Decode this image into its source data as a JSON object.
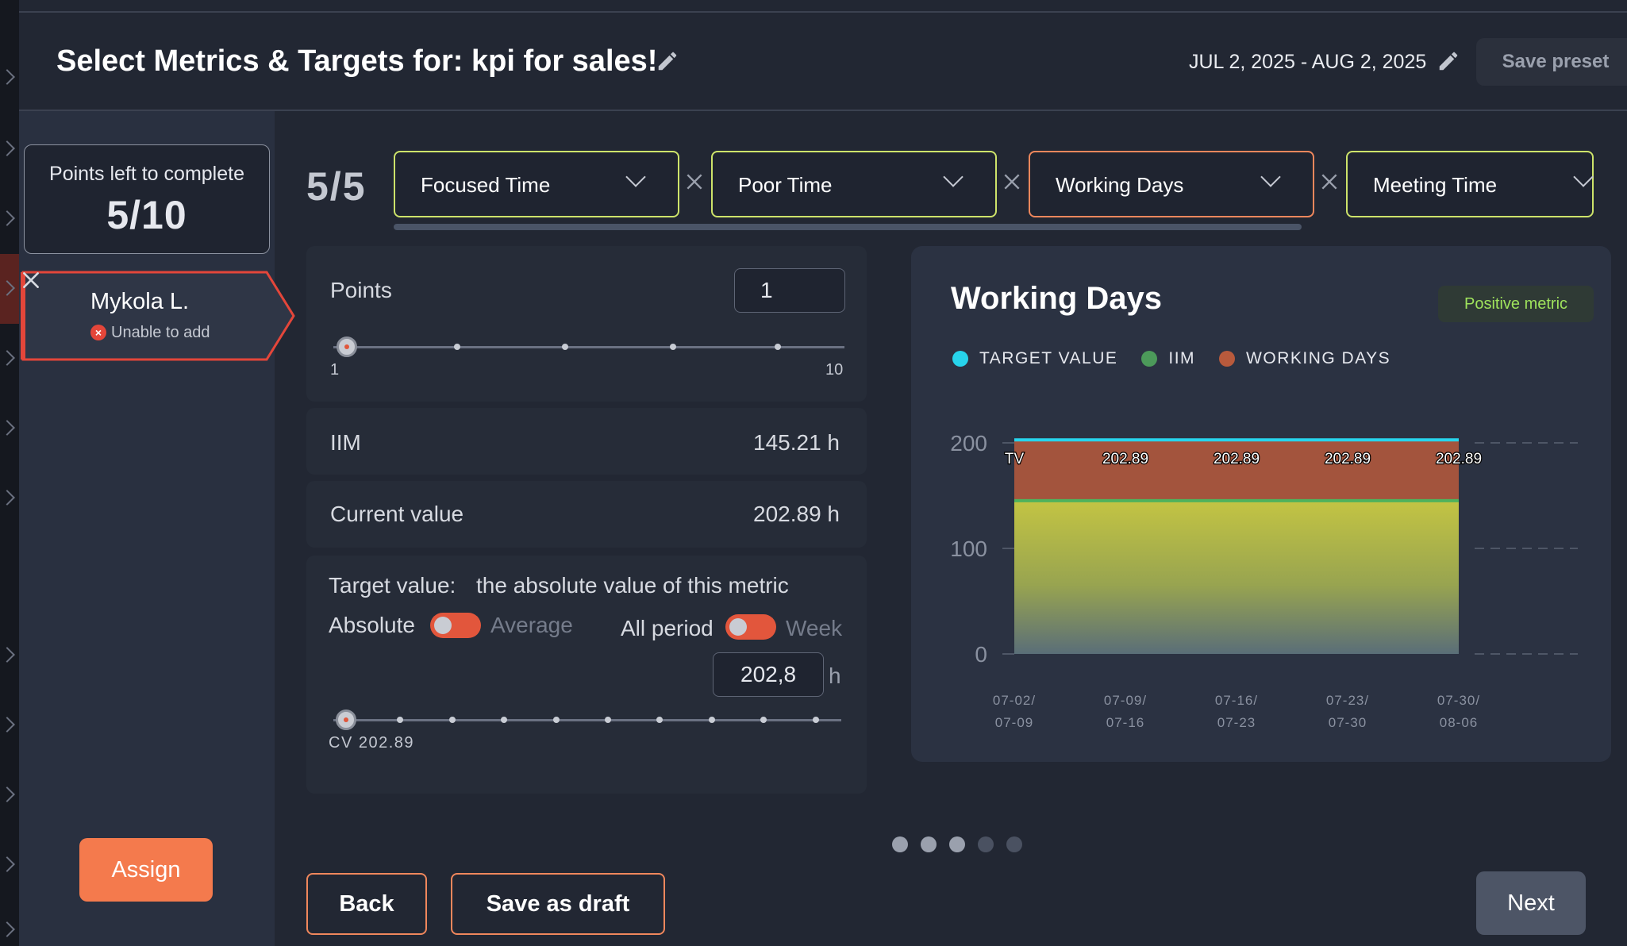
{
  "header": {
    "title": "Select Metrics & Targets for: kpi for sales!",
    "date_range": "JUL 2, 2025 - AUG 2, 2025",
    "save_preset": "Save preset"
  },
  "sidebar": {
    "points_label": "Points left to complete",
    "points_value": "5/10",
    "user": {
      "name": "Mykola L.",
      "status": "Unable to add"
    },
    "assign": "Assign"
  },
  "metrics": {
    "count": "5/5",
    "items": [
      {
        "label": "Focused Time",
        "state": "valid"
      },
      {
        "label": "Poor Time",
        "state": "valid"
      },
      {
        "label": "Working Days",
        "state": "selected"
      },
      {
        "label": "Meeting Time",
        "state": "valid"
      }
    ],
    "colors": {
      "valid": "#cde36a",
      "selected": "#f0875c"
    }
  },
  "settings": {
    "points_label": "Points",
    "points_value": "1",
    "points_min": "1",
    "points_max": "10",
    "points_level": 0,
    "iim_label": "IIM",
    "iim_value": "145.21 h",
    "current_label": "Current value",
    "current_value": "202.89 h",
    "target_label": "Target value:",
    "target_desc": "the absolute value of this metric",
    "absolute": "Absolute",
    "average": "Average",
    "all_period": "All period",
    "week": "Week",
    "target_value": "202,8",
    "target_unit": "h",
    "cv_label": "CV 202.89"
  },
  "chart": {
    "title": "Working Days",
    "badge": "Positive metric",
    "legend": [
      {
        "label": "TARGET VALUE",
        "color": "#27d4ec"
      },
      {
        "label": "IIM",
        "color": "#4c9a5a"
      },
      {
        "label": "WORKING DAYS",
        "color": "#b85a3c"
      }
    ]
  },
  "chart_data": {
    "type": "area",
    "title": "Working Days",
    "categories": [
      "07-02/07-09",
      "07-09/07-16",
      "07-16/07-23",
      "07-23/07-30",
      "07-30/08-06"
    ],
    "category_lines": [
      [
        "07-02/",
        "07-09"
      ],
      [
        "07-09/",
        "07-16"
      ],
      [
        "07-16/",
        "07-23"
      ],
      [
        "07-23/",
        "07-30"
      ],
      [
        "07-30/",
        "08-06"
      ]
    ],
    "y_ticks": [
      "200",
      "100",
      "0"
    ],
    "ylim": [
      0,
      200
    ],
    "series": [
      {
        "name": "TARGET VALUE",
        "values": [
          202.8,
          202.8,
          202.8,
          202.8,
          202.8
        ],
        "color": "#27d4ec"
      },
      {
        "name": "IIM",
        "values": [
          145.21,
          145.21,
          145.21,
          145.21,
          145.21
        ],
        "color": "#4c9a5a"
      },
      {
        "name": "WORKING DAYS",
        "values": [
          202.89,
          202.89,
          202.89,
          202.89,
          202.89
        ],
        "color": "#b85a3c"
      }
    ],
    "data_labels": [
      "TV",
      "202.89",
      "202.89",
      "202.89",
      "202.89"
    ]
  },
  "pagination": {
    "total": 5,
    "active": [
      0,
      1,
      2
    ]
  },
  "footer": {
    "back": "Back",
    "save_draft": "Save as draft",
    "next": "Next"
  }
}
